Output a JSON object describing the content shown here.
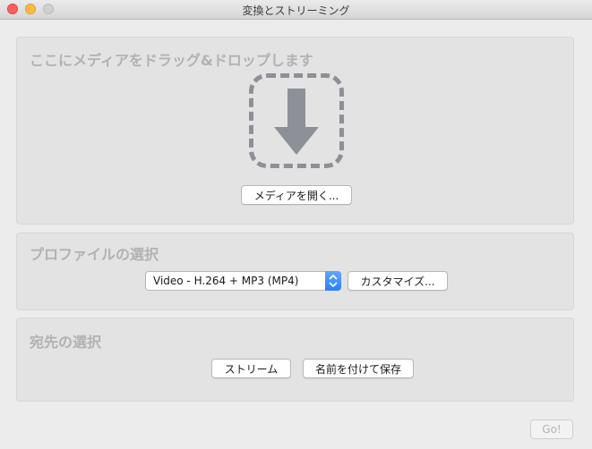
{
  "window": {
    "title": "変換とストリーミング"
  },
  "media": {
    "drop_label": "ここにメディアをドラッグ&ドロップします",
    "open_button": "メディアを開く..."
  },
  "profile": {
    "heading": "プロファイルの選択",
    "selected": "Video - H.264 + MP3 (MP4)",
    "customize_button": "カスタマイズ..."
  },
  "destination": {
    "heading": "宛先の選択",
    "stream_button": "ストリーム",
    "save_button": "名前を付けて保存"
  },
  "footer": {
    "go_button": "Go!"
  },
  "colors": {
    "accent": "#2b7ef6",
    "icon": "#8d9096"
  },
  "icons": {
    "drop": "download-arrow-icon",
    "select": "up-down-chevron-icon"
  }
}
